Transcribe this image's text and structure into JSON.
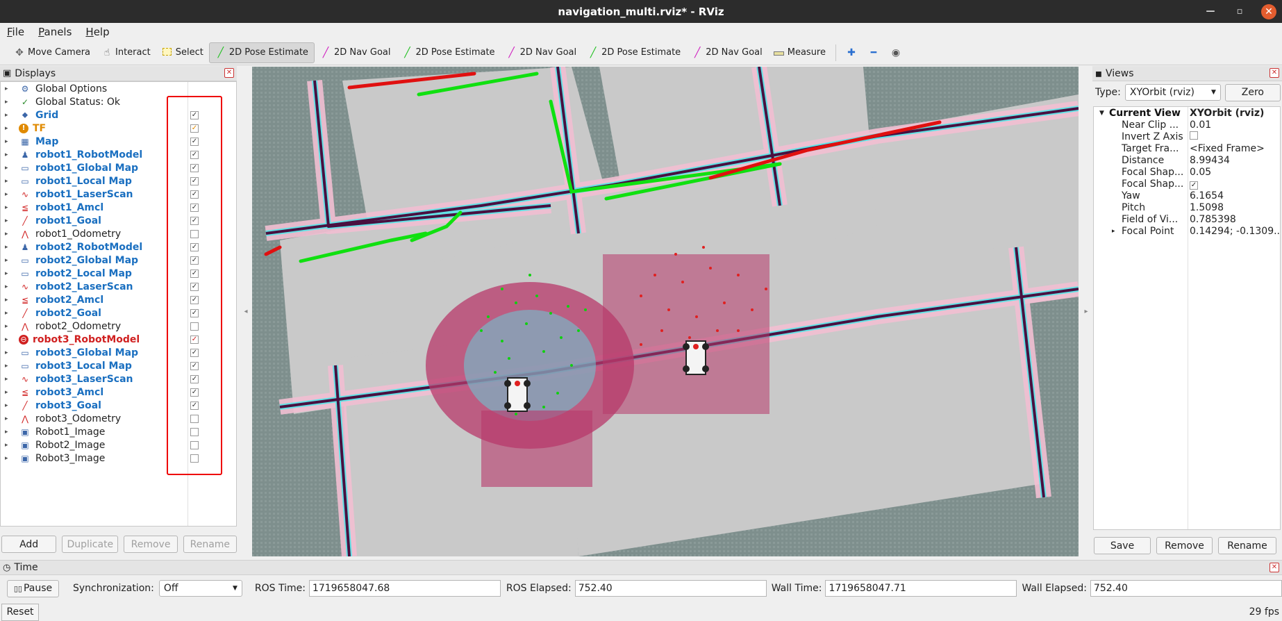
{
  "window": {
    "title": "navigation_multi.rviz* - RViz"
  },
  "menu": [
    {
      "label": "File",
      "key": "F",
      "rest": "ile"
    },
    {
      "label": "Panels",
      "key": "P",
      "rest": "anels"
    },
    {
      "label": "Help",
      "key": "H",
      "rest": "elp"
    }
  ],
  "toolbar": {
    "move_camera": "Move Camera",
    "interact": "Interact",
    "select": "Select",
    "pose1": "2D Pose Estimate",
    "nav1": "2D Nav Goal",
    "pose2": "2D Pose Estimate",
    "nav2": "2D Nav Goal",
    "pose3": "2D Pose Estimate",
    "nav3": "2D Nav Goal",
    "measure": "Measure"
  },
  "displays": {
    "title": "Displays",
    "items": [
      {
        "label": "Global Options",
        "style": "normal",
        "icon": "gear-icon",
        "glyph": "⚙",
        "checked": null
      },
      {
        "label": "Global Status: Ok",
        "style": "normal",
        "icon": "check-icon",
        "glyph": "✓",
        "checked": null
      },
      {
        "label": "Grid",
        "style": "blue",
        "icon": "grid-icon",
        "glyph": "⬥",
        "checked": true
      },
      {
        "label": "TF",
        "style": "orange",
        "icon": "warning-icon",
        "glyph": "!",
        "checked": true
      },
      {
        "label": "Map",
        "style": "blue",
        "icon": "map-icon",
        "glyph": "▦",
        "checked": true
      },
      {
        "label": "robot1_RobotModel",
        "style": "blue",
        "icon": "robot-model-icon",
        "glyph": "♟",
        "checked": true
      },
      {
        "label": "robot1_Global Map",
        "style": "blue",
        "icon": "folder-icon",
        "glyph": "▭",
        "checked": true
      },
      {
        "label": "robot1_Local Map",
        "style": "blue",
        "icon": "folder-icon",
        "glyph": "▭",
        "checked": true
      },
      {
        "label": "robot1_LaserScan",
        "style": "blue",
        "icon": "laser-scan-icon",
        "glyph": "∿",
        "checked": true
      },
      {
        "label": "robot1_Amcl",
        "style": "blue",
        "icon": "pose-array-icon",
        "glyph": "≦",
        "checked": true
      },
      {
        "label": "robot1_Goal",
        "style": "blue",
        "icon": "arrow-icon",
        "glyph": "╱",
        "checked": true
      },
      {
        "label": "robot1_Odometry",
        "style": "normal",
        "icon": "odometry-icon",
        "glyph": "⋀",
        "checked": false
      },
      {
        "label": "robot2_RobotModel",
        "style": "blue",
        "icon": "robot-model-icon",
        "glyph": "♟",
        "checked": true
      },
      {
        "label": "robot2_Global Map",
        "style": "blue",
        "icon": "folder-icon",
        "glyph": "▭",
        "checked": true
      },
      {
        "label": "robot2_Local Map",
        "style": "blue",
        "icon": "folder-icon",
        "glyph": "▭",
        "checked": true
      },
      {
        "label": "robot2_LaserScan",
        "style": "blue",
        "icon": "laser-scan-icon",
        "glyph": "∿",
        "checked": true
      },
      {
        "label": "robot2_Amcl",
        "style": "blue",
        "icon": "pose-array-icon",
        "glyph": "≦",
        "checked": true
      },
      {
        "label": "robot2_Goal",
        "style": "blue",
        "icon": "arrow-icon",
        "glyph": "╱",
        "checked": true
      },
      {
        "label": "robot2_Odometry",
        "style": "normal",
        "icon": "odometry-icon",
        "glyph": "⋀",
        "checked": false
      },
      {
        "label": "robot3_RobotModel",
        "style": "red",
        "icon": "error-icon",
        "glyph": "⊖",
        "checked": true
      },
      {
        "label": "robot3_Global Map",
        "style": "blue",
        "icon": "folder-icon",
        "glyph": "▭",
        "checked": true
      },
      {
        "label": "robot3_Local Map",
        "style": "blue",
        "icon": "folder-icon",
        "glyph": "▭",
        "checked": true
      },
      {
        "label": "robot3_LaserScan",
        "style": "blue",
        "icon": "laser-scan-icon",
        "glyph": "∿",
        "checked": true
      },
      {
        "label": "robot3_Amcl",
        "style": "blue",
        "icon": "pose-array-icon",
        "glyph": "≦",
        "checked": true
      },
      {
        "label": "robot3_Goal",
        "style": "blue",
        "icon": "arrow-icon",
        "glyph": "╱",
        "checked": true
      },
      {
        "label": "robot3_Odometry",
        "style": "normal",
        "icon": "odometry-icon",
        "glyph": "⋀",
        "checked": false
      },
      {
        "label": "Robot1_Image",
        "style": "normal",
        "icon": "image-icon",
        "glyph": "▣",
        "checked": false
      },
      {
        "label": "Robot2_Image",
        "style": "normal",
        "icon": "image-icon",
        "glyph": "▣",
        "checked": false
      },
      {
        "label": "Robot3_Image",
        "style": "normal",
        "icon": "image-icon",
        "glyph": "▣",
        "checked": false
      }
    ],
    "buttons": {
      "add": "Add",
      "duplicate": "Duplicate",
      "remove": "Remove",
      "rename": "Rename"
    }
  },
  "views": {
    "title": "Views",
    "type_label": "Type:",
    "type_value": "XYOrbit (rviz)",
    "zero": "Zero",
    "current_view": {
      "name": "Current View",
      "value": "XYOrbit (rviz)"
    },
    "props": [
      {
        "name": "Near Clip ...",
        "value": "0.01"
      },
      {
        "name": "Invert Z Axis",
        "value": "",
        "checkbox": false
      },
      {
        "name": "Target Fra...",
        "value": "<Fixed Frame>"
      },
      {
        "name": "Distance",
        "value": "8.99434"
      },
      {
        "name": "Focal Shap...",
        "value": "0.05"
      },
      {
        "name": "Focal Shap...",
        "value": "",
        "checkbox": true
      },
      {
        "name": "Yaw",
        "value": "6.1654"
      },
      {
        "name": "Pitch",
        "value": "1.5098"
      },
      {
        "name": "Field of Vi...",
        "value": "0.785398"
      },
      {
        "name": "Focal Point",
        "value": "0.14294; -0.1309...",
        "expandable": true
      }
    ],
    "buttons": {
      "save": "Save",
      "remove": "Remove",
      "rename": "Rename"
    }
  },
  "time": {
    "title": "Time",
    "pause": "Pause",
    "sync_label": "Synchronization:",
    "sync_value": "Off",
    "ros_time_label": "ROS Time:",
    "ros_time": "1719658047.68",
    "ros_elapsed_label": "ROS Elapsed:",
    "ros_elapsed": "752.40",
    "wall_time_label": "Wall Time:",
    "wall_time": "1719658047.71",
    "wall_elapsed_label": "Wall Elapsed:",
    "wall_elapsed": "752.40"
  },
  "status": {
    "reset": "Reset",
    "fps": "29 fps"
  },
  "colors": {
    "accent_blue": "#1a6fc0",
    "warn_orange": "#e08a00",
    "error_red": "#d02020",
    "map_gray": "#7e8f8d",
    "free_space": "#c8c8c8",
    "inflation_cyan": "#5fe3e6",
    "obstacle": "#4a1040",
    "path_green": "#10e010",
    "path_red": "#e01010"
  }
}
